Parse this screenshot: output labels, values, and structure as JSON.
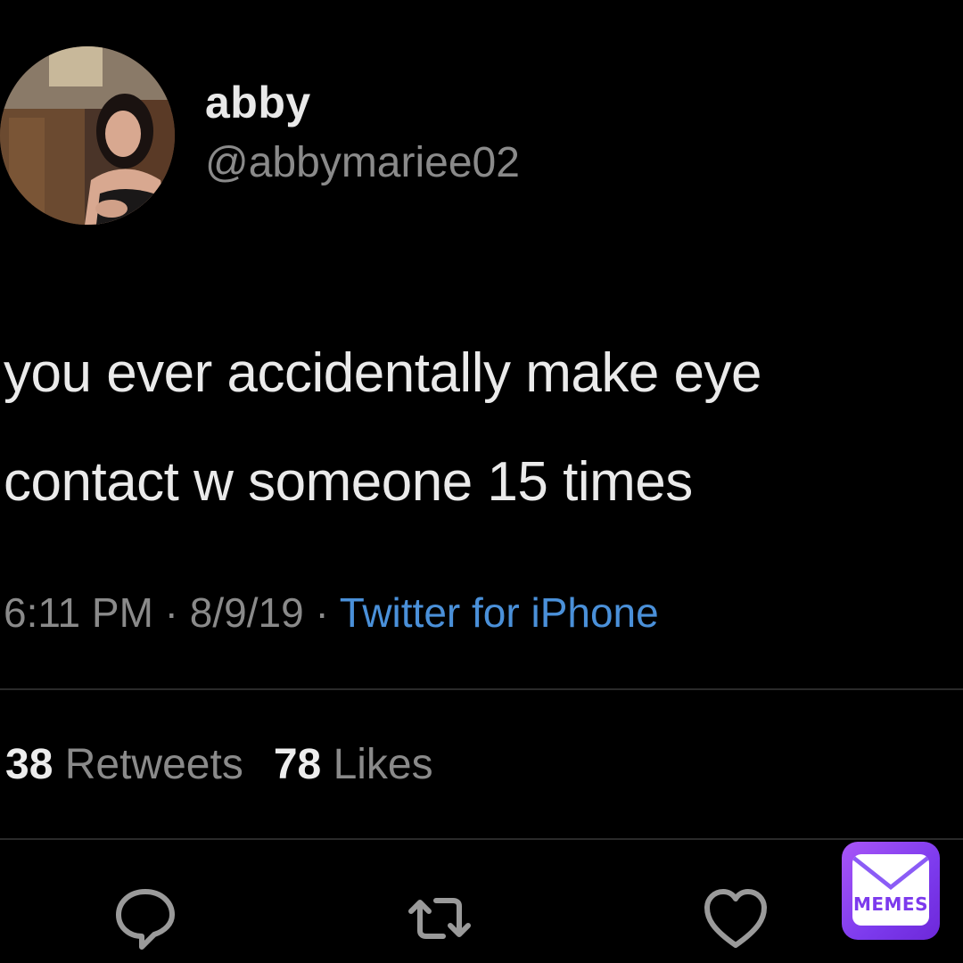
{
  "user": {
    "display_name": "abby",
    "handle": "@abbymariee02"
  },
  "tweet": {
    "lines": [
      "you ever accidentally make eye",
      "contact w someone 15 times"
    ]
  },
  "meta": {
    "time": "6:11 PM",
    "sep1": " · ",
    "date": "8/9/19",
    "sep2": " · ",
    "source": "Twitter for iPhone"
  },
  "stats": {
    "retweets_count": "38",
    "retweets_label": "Retweets",
    "likes_count": "78",
    "likes_label": "Likes"
  },
  "actions": [
    {
      "icon": "reply-icon"
    },
    {
      "icon": "retweet-icon"
    },
    {
      "icon": "like-icon"
    }
  ],
  "watermark": {
    "label": "MEMES"
  },
  "colors": {
    "background": "#000000",
    "text": "#eaeaea",
    "muted": "#8a8a8a",
    "link": "#4a90d9",
    "badge": "#7c3aed"
  }
}
